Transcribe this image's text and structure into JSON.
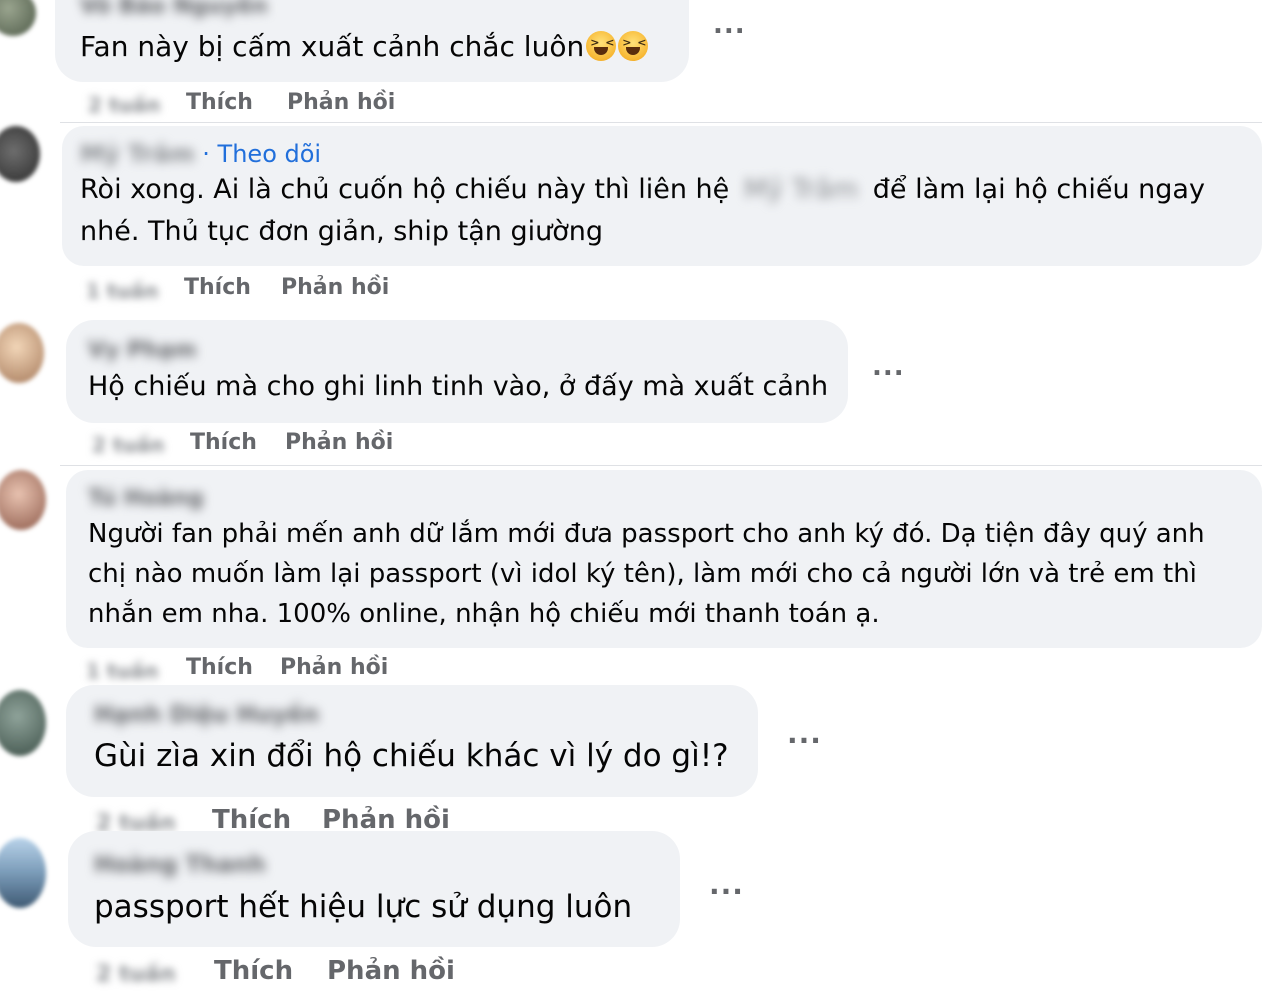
{
  "menu": {
    "more_label": "..."
  },
  "comments": [
    {
      "author": "Võ Bảo Nguyễn",
      "text": "Fan này bị cấm xuất cảnh chắc luôn",
      "emoji": [
        "grinning-squinting-face-icon",
        "grinning-squinting-face-icon"
      ],
      "time": "2 tuần",
      "like_label": "Thích",
      "reply_label": "Phản hồi"
    },
    {
      "author": "Mỹ Trâm",
      "follow_label": "· Theo dõi",
      "text_line1_a": "Ròi xong. Ai là chủ cuốn hộ chiếu này thì liên hệ",
      "text_line1_mention": "Mỹ Trâm",
      "text_line1_b": "để làm lại hộ chiếu ngay",
      "text_line2": "nhé. Thủ tục đơn giản, ship tận giường",
      "time": "1 tuần",
      "like_label": "Thích",
      "reply_label": "Phản hồi"
    },
    {
      "author": "Vy Phạm",
      "text": "Hộ chiếu mà cho ghi linh tinh vào, ở đấy mà xuất cảnh",
      "time": "2 tuần",
      "like_label": "Thích",
      "reply_label": "Phản hồi"
    },
    {
      "author": "Tú Hoàng",
      "text_line1": "Người fan phải mến anh dữ lắm mới đưa passport cho anh ký đó. Dạ tiện đây quý anh",
      "text_line2": "chị nào muốn làm lại passport (vì idol ký tên), làm mới cho cả người lớn và trẻ em thì",
      "text_line3": "nhắn em nha. 100% online, nhận hộ chiếu mới thanh toán ạ.",
      "time": "1 tuần",
      "like_label": "Thích",
      "reply_label": "Phản hồi"
    },
    {
      "author": "Hạnh Diệu Huyền",
      "text": "Gùi zìa xin đổi hộ chiếu khác vì lý do gì!?",
      "time": "2 tuần",
      "like_label": "Thích",
      "reply_label": "Phản hồi"
    },
    {
      "author": "Hoàng Thanh",
      "text": "passport hết hiệu lực sử dụng luôn",
      "time": "2 tuần",
      "like_label": "Thích",
      "reply_label": "Phản hồi"
    }
  ]
}
